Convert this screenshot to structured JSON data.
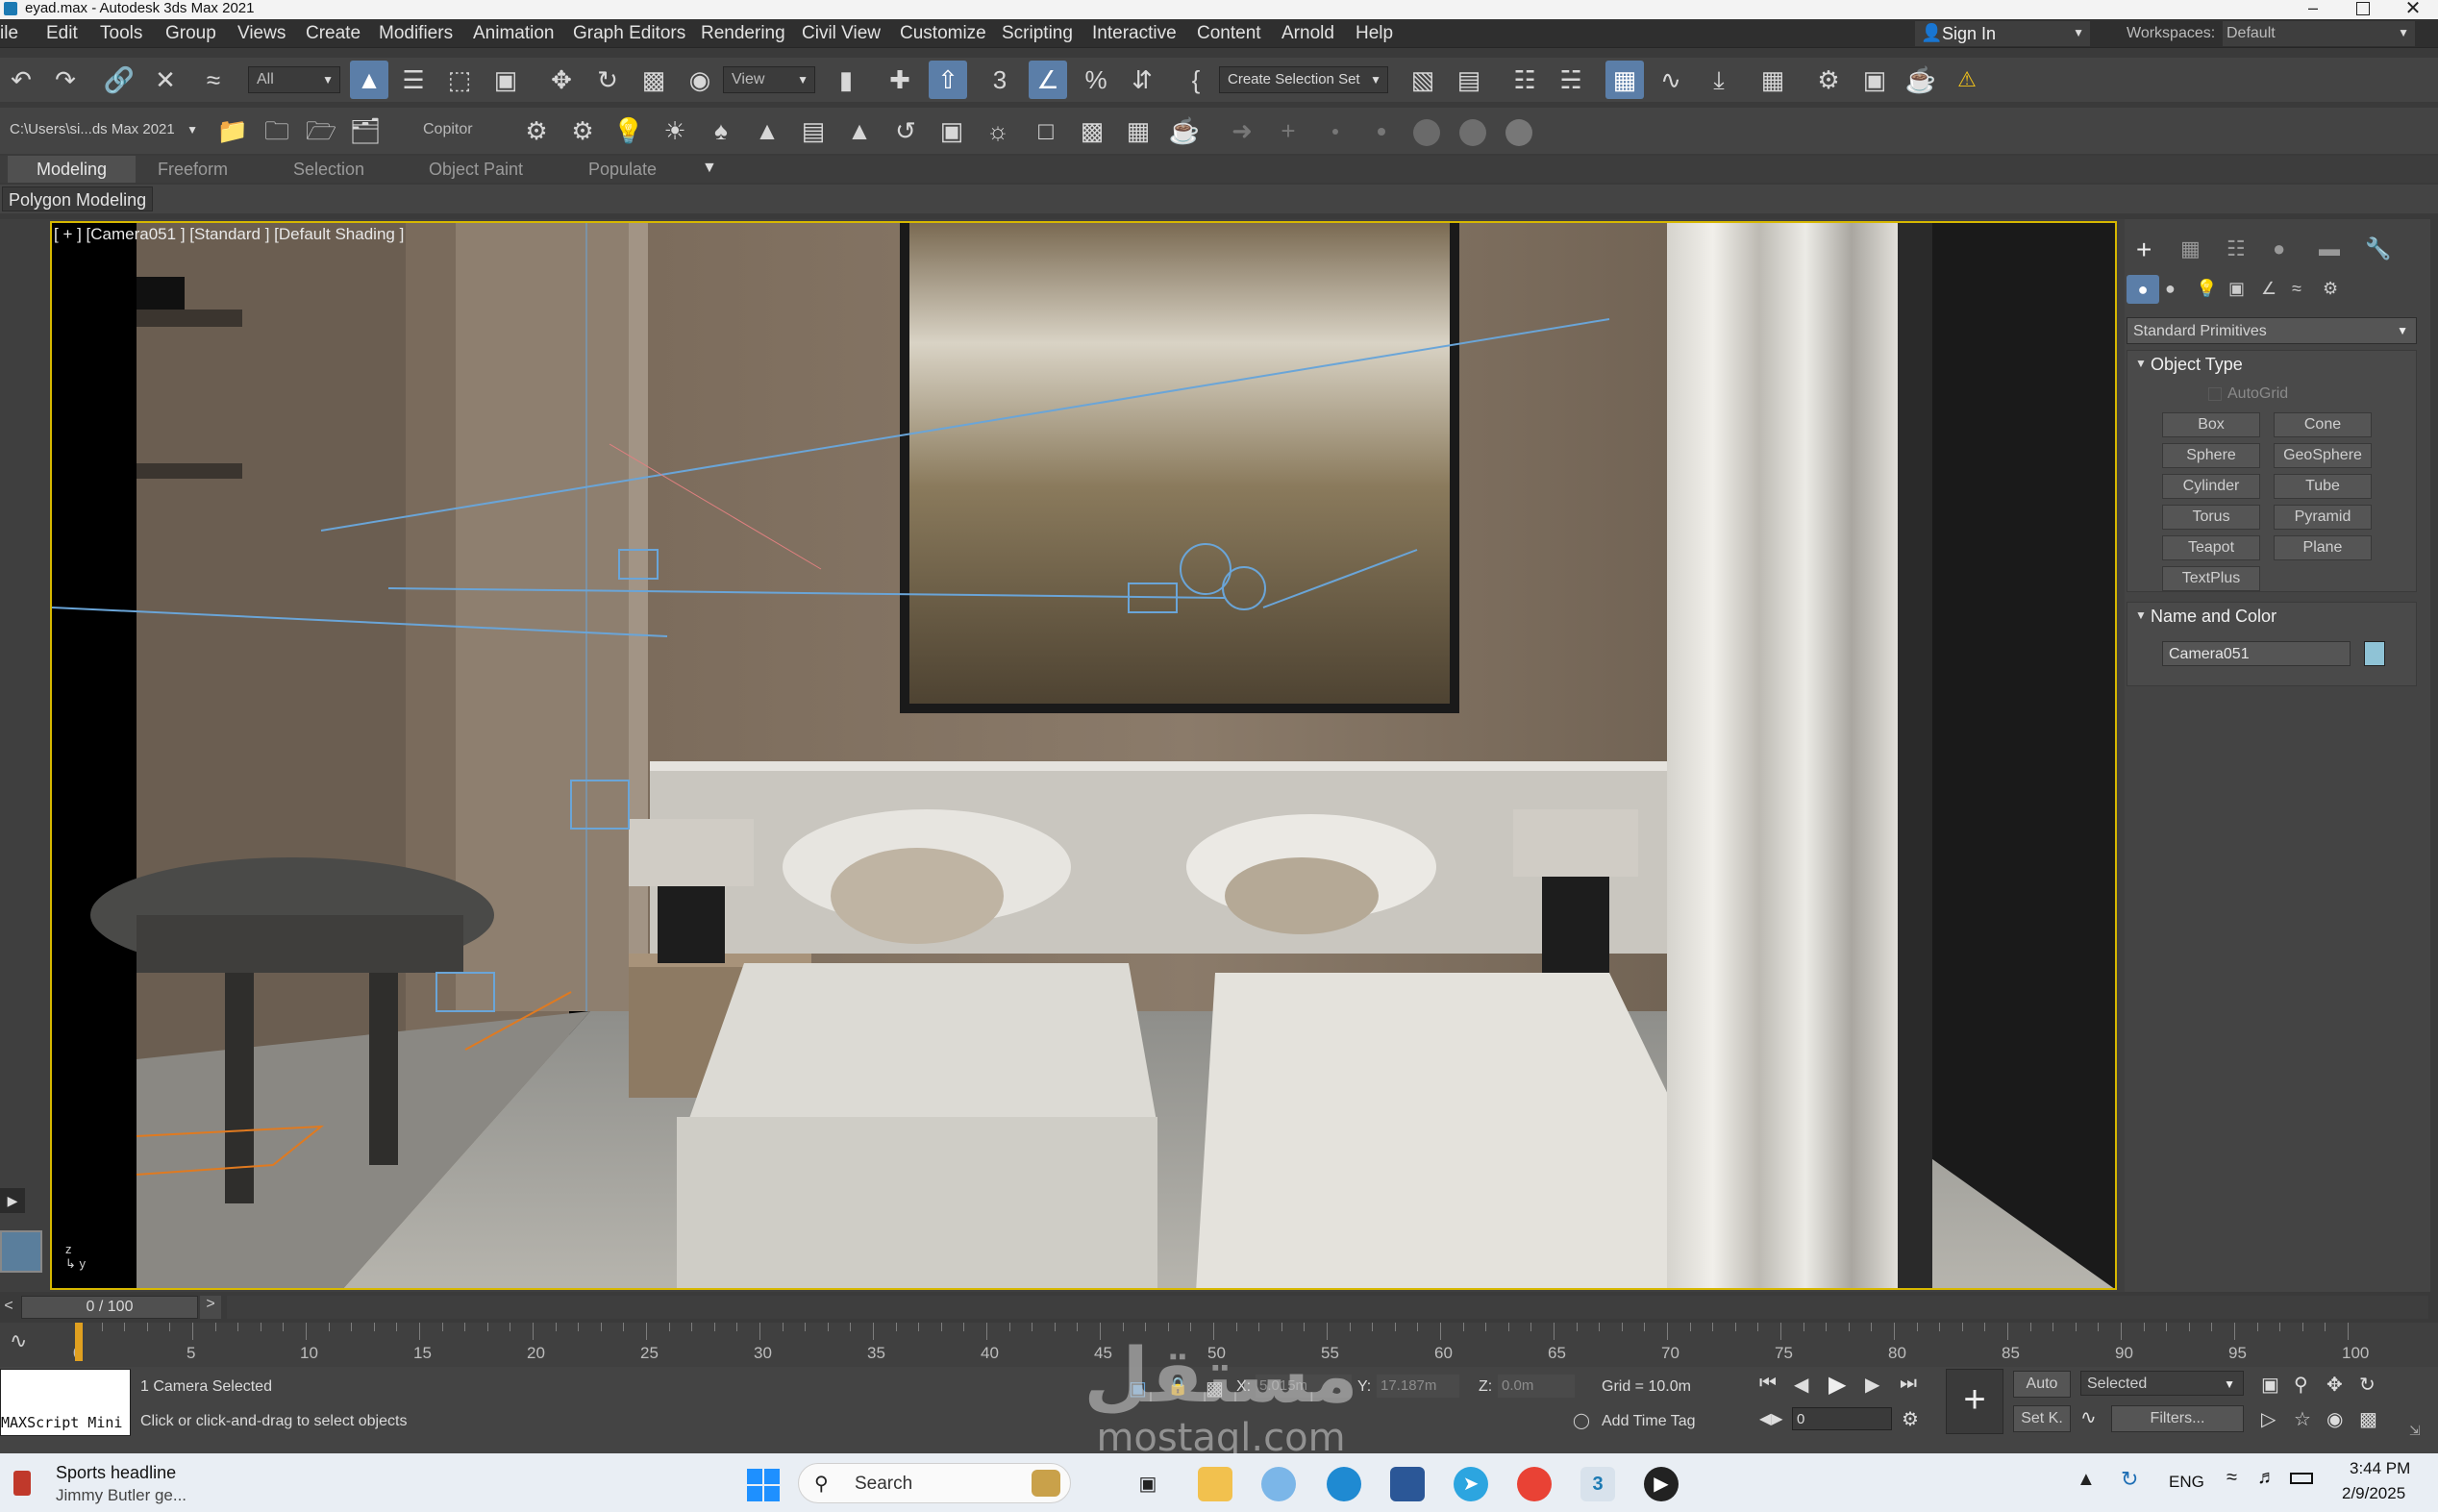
{
  "window": {
    "title": "eyad.max - Autodesk 3ds Max 2021"
  },
  "menu": [
    "ile",
    "Edit",
    "Tools",
    "Group",
    "Views",
    "Create",
    "Modifiers",
    "Animation",
    "Graph Editors",
    "Rendering",
    "Civil View",
    "Customize",
    "Scripting",
    "Interactive",
    "Content",
    "Arnold",
    "Help"
  ],
  "account": {
    "sign_in": "Sign In",
    "workspaces_label": "Workspaces:",
    "workspace_value": "Default"
  },
  "toolbar": {
    "filter_value": "All",
    "refcoord_value": "View",
    "selection_set_value": "Create Selection Set",
    "path_value": "C:\\Users\\si...ds Max 2021",
    "copitor_label": "Copitor"
  },
  "ribbon": {
    "tabs": [
      "Modeling",
      "Freeform",
      "Selection",
      "Object Paint",
      "Populate"
    ],
    "active": "Modeling",
    "sub_label": "Polygon Modeling"
  },
  "viewport": {
    "label": "[ + ] [Camera051 ] [Standard ] [Default Shading ]"
  },
  "command_panel": {
    "category_value": "Standard Primitives",
    "object_type_title": "Object Type",
    "autogrid": "AutoGrid",
    "buttons": [
      "Box",
      "Cone",
      "Sphere",
      "GeoSphere",
      "Cylinder",
      "Tube",
      "Torus",
      "Pyramid",
      "Teapot",
      "Plane",
      "TextPlus"
    ],
    "name_color_title": "Name and Color",
    "object_name": "Camera051",
    "object_color": "#8fc3d6"
  },
  "timeline": {
    "frame_display": "0 / 100",
    "prev": "<",
    "next": ">",
    "ticks": [
      "0",
      "5",
      "10",
      "15",
      "20",
      "25",
      "30",
      "35",
      "40",
      "45",
      "50",
      "55",
      "60",
      "65",
      "70",
      "75",
      "80",
      "85",
      "90",
      "95",
      "100"
    ]
  },
  "status": {
    "maxscript": "MAXScript Mini",
    "selection_info": "1 Camera Selected",
    "prompt": "Click or click-and-drag to select objects",
    "x_label": "X:",
    "x_value": "5.015m",
    "y_label": "Y:",
    "y_value": "17.187m",
    "z_label": "Z:",
    "z_value": "0.0m",
    "grid": "Grid = 10.0m",
    "add_time_tag": "Add Time Tag",
    "auto": "Auto",
    "set_k": "Set K.",
    "key_filter_value": "Selected",
    "filters": "Filters...",
    "frame_field": "0"
  },
  "taskbar": {
    "news_title": "Sports headline",
    "news_sub": "Jimmy Butler ge...",
    "search": "Search",
    "lang": "ENG",
    "time": "3:44 PM",
    "date": "2/9/2025"
  },
  "watermark": {
    "arabic": "مستقل",
    "latin": "mostaql.com"
  }
}
